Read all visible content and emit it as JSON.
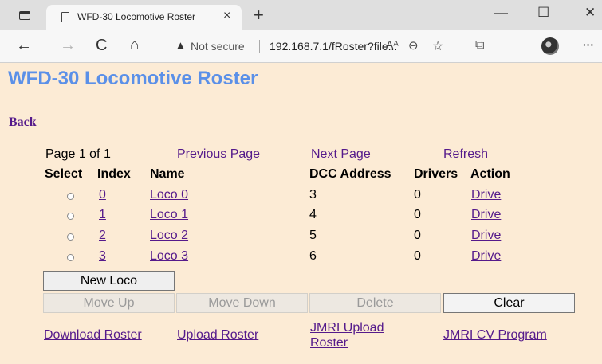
{
  "browser": {
    "tab_title": "WFD-30 Locomotive Roster",
    "tab_close": "×",
    "new_tab": "+",
    "win_minimize": "—",
    "win_maximize": "☐",
    "win_close": "✕",
    "security_label": "Not secure",
    "url": "192.168.7.1/fRoster?file...",
    "back_glyph": "←",
    "forward_glyph": "→",
    "reload_glyph": "C",
    "home_glyph": "⌂",
    "warning_glyph": "▲",
    "read_aloud_glyph": "Aᴬ",
    "zoom_glyph": "⊖",
    "favorite_glyph": "☆",
    "collections_glyph": "⧉",
    "menu_glyph": "···"
  },
  "page": {
    "title": "WFD-30 Locomotive Roster",
    "back_link": "Back",
    "page_info": "Page 1 of 1",
    "prev_page": "Previous Page",
    "next_page": "Next Page",
    "refresh": "Refresh",
    "columns": {
      "select": "Select",
      "index": "Index",
      "name": "Name",
      "dcc": "DCC Address",
      "drivers": "Drivers",
      "action": "Action"
    },
    "rows": [
      {
        "index": "0",
        "name": "Loco 0",
        "dcc": "3",
        "drivers": "0",
        "action": "Drive"
      },
      {
        "index": "1",
        "name": "Loco 1",
        "dcc": "4",
        "drivers": "0",
        "action": "Drive"
      },
      {
        "index": "2",
        "name": "Loco 2",
        "dcc": "5",
        "drivers": "0",
        "action": "Drive"
      },
      {
        "index": "3",
        "name": "Loco 3",
        "dcc": "6",
        "drivers": "0",
        "action": "Drive"
      }
    ],
    "buttons": {
      "new_loco": "New Loco",
      "move_up": "Move Up",
      "move_down": "Move Down",
      "delete": "Delete",
      "clear": "Clear"
    },
    "links": {
      "download": "Download Roster",
      "upload": "Upload Roster",
      "jmri_upload_1": "JMRI Upload",
      "jmri_upload_2": "Roster",
      "jmri_cv": "JMRI CV Program"
    }
  }
}
